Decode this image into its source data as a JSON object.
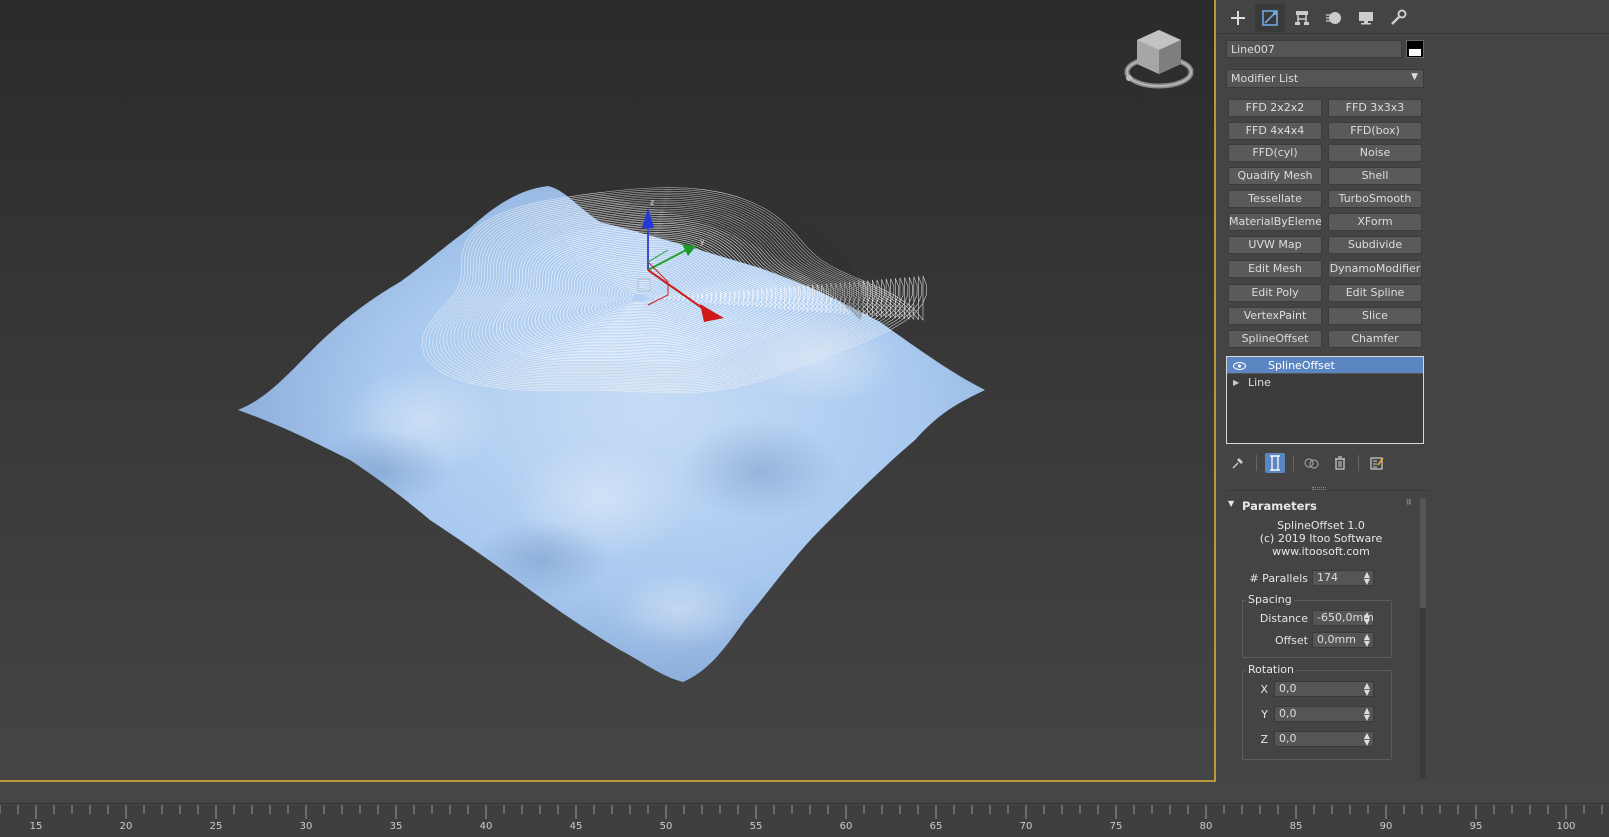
{
  "object_name": "Line007",
  "modifier_list": {
    "label": "Modifier List"
  },
  "modifier_buttons": [
    "FFD 2x2x2",
    "FFD 3x3x3",
    "FFD 4x4x4",
    "FFD(box)",
    "FFD(cyl)",
    "Noise",
    "Quadify Mesh",
    "Shell",
    "Tessellate",
    "TurboSmooth",
    "MaterialByElement",
    "XForm",
    "UVW Map",
    "Subdivide",
    "Edit Mesh",
    "DynamoModifier",
    "Edit Poly",
    "Edit Spline",
    "VertexPaint",
    "Slice",
    "SplineOffset",
    "Chamfer"
  ],
  "stack": {
    "items": [
      {
        "label": "SplineOffset",
        "selected": true
      },
      {
        "label": "Line",
        "selected": false
      }
    ]
  },
  "parameters": {
    "title": "Parameters",
    "about_line1": "SplineOffset 1.0",
    "about_line2": "(c) 2019 Itoo Software",
    "about_line3": "www.itoosoft.com",
    "parallels_label": "# Parallels",
    "parallels_value": "174",
    "spacing_group": "Spacing",
    "distance_label": "Distance",
    "distance_value": "-650,0mm",
    "offset_label": "Offset",
    "offset_value": "0,0mm",
    "rotation_group": "Rotation",
    "x_label": "X",
    "x_value": "0,0",
    "y_label": "Y",
    "y_value": "0,0",
    "z_label": "Z",
    "z_value": "0,0"
  },
  "timeline": {
    "labels": [
      "15",
      "20",
      "25",
      "30",
      "35",
      "40",
      "45",
      "50",
      "55",
      "60",
      "65",
      "70",
      "75",
      "80",
      "85",
      "90",
      "95",
      "100"
    ]
  },
  "colors": {
    "accent": "#5b86c2",
    "viewport_border": "#b99a3a",
    "surface": "#a9c9ef"
  },
  "icons": {
    "tabs": [
      "create-icon",
      "modify-icon",
      "hierarchy-icon",
      "motion-icon",
      "display-icon",
      "utilities-icon"
    ],
    "stack_tools": [
      "pin-stack-icon",
      "show-end-result-icon",
      "make-unique-icon",
      "remove-modifier-icon",
      "configure-modifier-sets-icon"
    ]
  }
}
